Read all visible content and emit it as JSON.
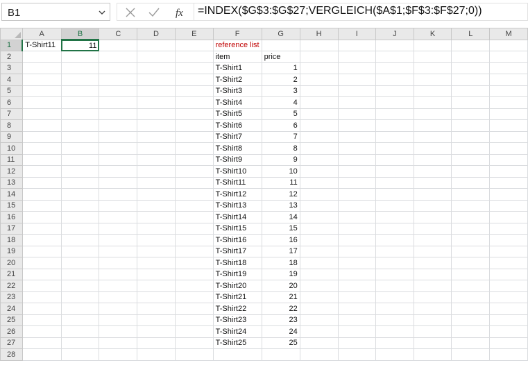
{
  "formula_bar": {
    "name_box": "B1",
    "formula": "=INDEX($G$3:$G$27;VERGLEICH($A$1;$F$3:$F$27;0))"
  },
  "columns": [
    "A",
    "B",
    "C",
    "D",
    "E",
    "F",
    "G",
    "H",
    "I",
    "J",
    "K",
    "L",
    "M"
  ],
  "selected_column": "B",
  "selected_row": "1",
  "cells": {
    "A1": "T-Shirt11",
    "B1": "11",
    "F1": "reference list",
    "F2": "item",
    "G2": "price"
  },
  "reference_list": [
    {
      "item": "T-Shirt1",
      "price": "1"
    },
    {
      "item": "T-Shirt2",
      "price": "2"
    },
    {
      "item": "T-Shirt3",
      "price": "3"
    },
    {
      "item": "T-Shirt4",
      "price": "4"
    },
    {
      "item": "T-Shirt5",
      "price": "5"
    },
    {
      "item": "T-Shirt6",
      "price": "6"
    },
    {
      "item": "T-Shirt7",
      "price": "7"
    },
    {
      "item": "T-Shirt8",
      "price": "8"
    },
    {
      "item": "T-Shirt9",
      "price": "9"
    },
    {
      "item": "T-Shirt10",
      "price": "10"
    },
    {
      "item": "T-Shirt11",
      "price": "11"
    },
    {
      "item": "T-Shirt12",
      "price": "12"
    },
    {
      "item": "T-Shirt13",
      "price": "13"
    },
    {
      "item": "T-Shirt14",
      "price": "14"
    },
    {
      "item": "T-Shirt15",
      "price": "15"
    },
    {
      "item": "T-Shirt16",
      "price": "16"
    },
    {
      "item": "T-Shirt17",
      "price": "17"
    },
    {
      "item": "T-Shirt18",
      "price": "18"
    },
    {
      "item": "T-Shirt19",
      "price": "19"
    },
    {
      "item": "T-Shirt20",
      "price": "20"
    },
    {
      "item": "T-Shirt21",
      "price": "21"
    },
    {
      "item": "T-Shirt22",
      "price": "22"
    },
    {
      "item": "T-Shirt23",
      "price": "23"
    },
    {
      "item": "T-Shirt24",
      "price": "24"
    },
    {
      "item": "T-Shirt25",
      "price": "25"
    }
  ],
  "row_numbers": [
    "1",
    "2",
    "3",
    "4",
    "5",
    "6",
    "7",
    "8",
    "9",
    "10",
    "11",
    "12",
    "13",
    "14",
    "15",
    "16",
    "17",
    "18",
    "19",
    "20",
    "21",
    "22",
    "23",
    "24",
    "25",
    "26",
    "27",
    "28"
  ],
  "colors": {
    "accent": "#217346",
    "red_text": "#c00000"
  },
  "icons": {
    "cancel": "close-icon",
    "enter": "check-icon",
    "function": "fx-icon",
    "dropdown": "chevron-down-icon"
  }
}
